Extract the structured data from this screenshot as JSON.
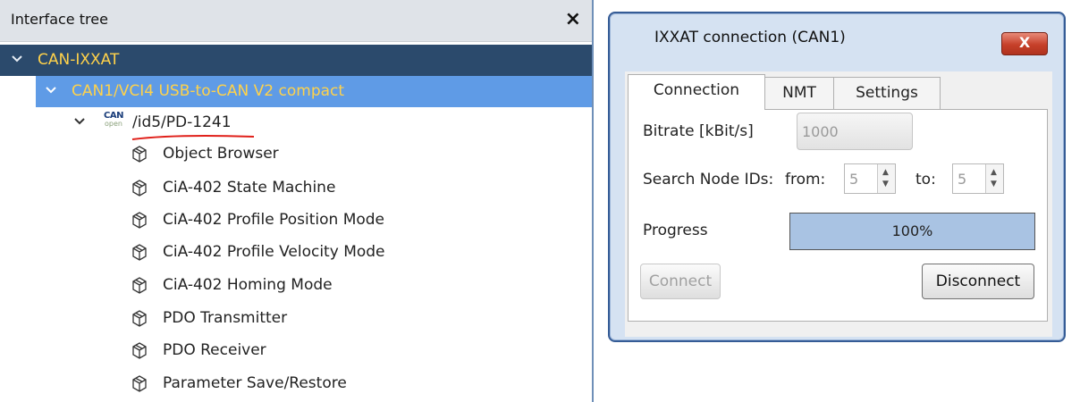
{
  "tree": {
    "title": "Interface tree",
    "close_glyph": "×",
    "root": {
      "label": "CAN-IXXAT"
    },
    "device": {
      "label": "CAN1/VCI4 USB-to-CAN V2 compact"
    },
    "node": {
      "label": "/id5/PD-1241",
      "icon": "canopen-icon",
      "icon_text_top": "CAN",
      "icon_text_bottom": "open"
    },
    "items": [
      {
        "label": "Object Browser"
      },
      {
        "label": "CiA-402 State Machine"
      },
      {
        "label": "CiA-402 Profile Position Mode"
      },
      {
        "label": "CiA-402 Profile Velocity Mode"
      },
      {
        "label": "CiA-402 Homing Mode"
      },
      {
        "label": "PDO Transmitter"
      },
      {
        "label": "PDO Receiver"
      },
      {
        "label": "Parameter Save/Restore"
      }
    ]
  },
  "dialog": {
    "title": "IXXAT connection (CAN1)",
    "close_glyph": "X",
    "tabs": [
      {
        "label": "Connection",
        "active": true
      },
      {
        "label": "NMT",
        "active": false
      },
      {
        "label": "Settings",
        "active": false
      }
    ],
    "bitrate": {
      "label": "Bitrate [kBit/s]",
      "value": "1000"
    },
    "search": {
      "label": "Search Node IDs:",
      "from_label": "from:",
      "from_value": "5",
      "to_label": "to:",
      "to_value": "5"
    },
    "progress": {
      "label": "Progress",
      "value": 1.0,
      "text": "100%"
    },
    "buttons": {
      "connect": "Connect",
      "disconnect": "Disconnect"
    }
  },
  "colors": {
    "tree_root_bg": "#2b4a6c",
    "tree_selected_bg": "#5f9be6",
    "tree_highlight_text": "#ffd24a",
    "dialog_frame": "#355c96",
    "progress_fill": "#a9c3e3",
    "close_button": "#c6402a",
    "annotation_underline": "#e0201a"
  }
}
